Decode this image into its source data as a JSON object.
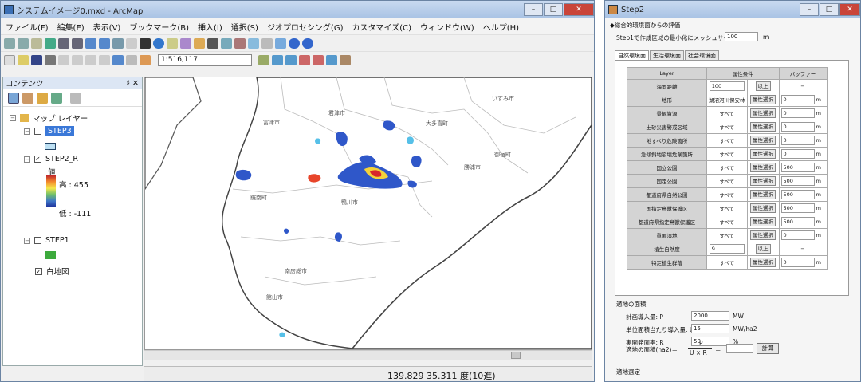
{
  "arcmap": {
    "title": "システムイメージ0.mxd - ArcMap",
    "menu": [
      "ファイル(F)",
      "編集(E)",
      "表示(V)",
      "ブックマーク(B)",
      "挿入(I)",
      "選択(S)",
      "ジオプロセシング(G)",
      "カスタマイズ(C)",
      "ウィンドウ(W)",
      "ヘルプ(H)"
    ],
    "scale": "1:516,117",
    "toc": {
      "title": "コンテンツ",
      "pin": "♯ ✕",
      "root": "マップ レイヤー",
      "step3": "STEP3",
      "step2": "STEP2_R",
      "legend_value": "値",
      "legend_high": "高 : 455",
      "legend_low": "低 : -111",
      "step1": "STEP1",
      "basemap": "白地図"
    },
    "map_labels": [
      "富津市",
      "君津市",
      "大多喜町",
      "いすみ市",
      "鴨川市",
      "勝浦市",
      "御宿町",
      "鋸南町",
      "鴨川市",
      "南房総市",
      "館山市"
    ],
    "status": "139.829  35.311 度(10進)"
  },
  "dialog": {
    "title": "Step2",
    "section1": "◆総合的環境面からの評価",
    "mesh_label": "Step1で作成区域の最小化にメッシュサイズ",
    "mesh_value": "100",
    "mesh_unit": "m",
    "tabs": [
      "自然環境面",
      "生活環境面",
      "社会環境面"
    ],
    "headers": [
      "Layer",
      "属性条件",
      "バッファー"
    ],
    "rows": [
      {
        "name": "海面距離",
        "cond": "100",
        "btn": "以上",
        "buf": "−",
        "unit": ""
      },
      {
        "name": "地形",
        "cond": "湖沼河川保安林",
        "btn": "属性選択",
        "buf": "0",
        "unit": "m"
      },
      {
        "name": "景観資源",
        "cond": "すべて",
        "btn": "属性選択",
        "buf": "0",
        "unit": "m"
      },
      {
        "name": "土砂災害警戒区域",
        "cond": "すべて",
        "btn": "属性選択",
        "buf": "0",
        "unit": "m"
      },
      {
        "name": "地すべり危険箇所",
        "cond": "すべて",
        "btn": "属性選択",
        "buf": "0",
        "unit": "m"
      },
      {
        "name": "急傾斜地崩壊危険箇所",
        "cond": "すべて",
        "btn": "属性選択",
        "buf": "0",
        "unit": "m"
      },
      {
        "name": "国立公園",
        "cond": "すべて",
        "btn": "属性選択",
        "buf": "500",
        "unit": "m"
      },
      {
        "name": "国定公園",
        "cond": "すべて",
        "btn": "属性選択",
        "buf": "500",
        "unit": "m"
      },
      {
        "name": "都道府県自然公園",
        "cond": "すべて",
        "btn": "属性選択",
        "buf": "500",
        "unit": "m"
      },
      {
        "name": "国指定鳥獣保護区",
        "cond": "すべて",
        "btn": "属性選択",
        "buf": "500",
        "unit": "m"
      },
      {
        "name": "都道府県指定鳥獣保護区",
        "cond": "すべて",
        "btn": "属性選択",
        "buf": "500",
        "unit": "m"
      },
      {
        "name": "重要湿地",
        "cond": "すべて",
        "btn": "属性選択",
        "buf": "0",
        "unit": "m"
      },
      {
        "name": "植生自然度",
        "cond": "9",
        "btn": "以上",
        "buf": "−",
        "unit": ""
      },
      {
        "name": "特定植生群落",
        "cond": "すべて",
        "btn": "属性選択",
        "buf": "0",
        "unit": "m"
      }
    ],
    "section2": "適地の面積",
    "calc": [
      {
        "label": "計画導入量: P",
        "value": "2000",
        "unit": "MW"
      },
      {
        "label": "単位面積当たり導入量: U",
        "value": "15",
        "unit": "MW/ha2"
      },
      {
        "label": "実開発面率: R",
        "value": "50",
        "unit": "%"
      }
    ],
    "formula_label": "適地の面積(ha2)＝",
    "formula_num": "P",
    "formula_den": "U × R",
    "formula_eq": "＝",
    "calc_btn": "計算",
    "section3": "適地選定"
  }
}
